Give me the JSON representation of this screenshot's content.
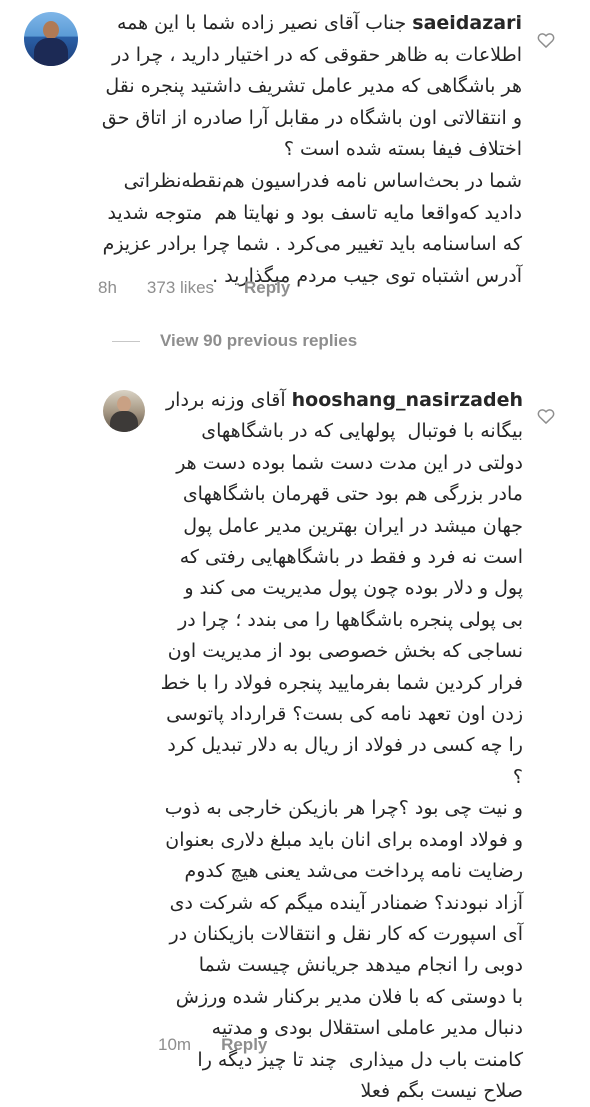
{
  "comments": [
    {
      "username": "saeidazari",
      "text": " جناب آقای نصیر زاده شما با این همه\nاطلاعات به ظاهر حقوقی که در اختیار دارید ، چرا در\nهر باشگاهی که مدیر عامل تشریف داشتید پنجره نقل\nو انتقالاتی اون باشگاه در مقابل آرا صادره از اتاق حق\nاختلاف فیفا بسته شده است ؟\nشما در بحث‌اساس نامه فدراسیون هم‌نقطه‌نظراتی\nدادید که‌واقعا مایه تاسف بود و نهایتا هم  متوجه شدید\nکه اساسنامه باید تغییر می‌کرد . شما چرا برادر عزیزم\nآدرس اشتباه توی جیب مردم میگذارید .",
      "time": "8h",
      "likes": "373 likes",
      "reply_label": "Reply"
    },
    {
      "username": "hooshang_nasirzadeh",
      "text": " آقای وزنه بردار\nبیگانه با فوتبال  پولهایی که در باشگاههای\nدولتی در این مدت دست شما بوده دست هر\nمادر بزرگی هم بود حتی قهرمان باشگاههای\nجهان میشد در ایران بهترین مدیر عامل پول\nاست نه فرد و فقط در باشگاههایی رفتی که\nپول و دلار بوده چون پول مدیریت می کند و\nبی پولی پنجره باشگاهها را می بندد ؛ چرا در\nنساجی که بخش خصوصی بود از مدیریت اون\nفرار کردین شما بفرمایید پنجره فولاد را با خط\nزدن اون تعهد نامه کی بست؟ قرارداد پاتوسی\nرا چه کسی در فولاد از ریال به دلار تبدیل کرد ؟\nو نیت چی بود ؟چرا هر بازیکن خارجی به ذوب\nو فولاد اومده برای انان باید مبلغ دلاری بعنوان\nرضایت نامه پرداخت می‌شد یعنی هیچ کدوم\nآزاد نبودند؟ ضمنادر آینده میگم که شرکت دی\nآی اسپورت که کار نقل و انتقالات بازیکنان در\nدوبی را انجام میدهد جریانش چیست شما\nبا دوستی که با فلان مدیر برکنار شده ورزش\nدنبال مدیر عاملی استقلال بودی و مدتیه\nکامنت باب دل میذاری  چند تا چیز دیگه را\nصلاح نیست بگم فعلا",
      "time": "10m",
      "reply_label": "Reply"
    }
  ],
  "view_replies_label": "View 90 previous replies",
  "icons": {
    "like": "heart-outline-icon",
    "avatar_1": "profile-photo-saeidazari",
    "avatar_2": "profile-photo-hooshang-nasirzadeh"
  },
  "colors": {
    "text": "#262626",
    "meta": "#8e8e8e"
  }
}
